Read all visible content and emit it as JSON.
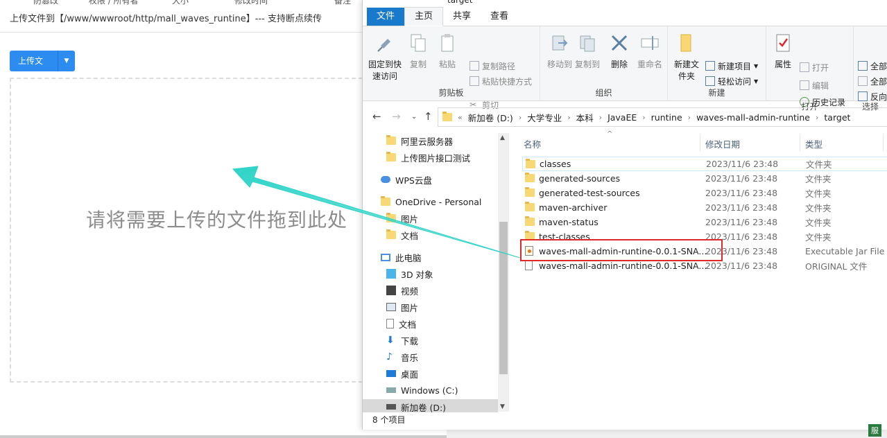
{
  "upload": {
    "col_headers": [
      "防篡改",
      "权限 / 所有者",
      "大小",
      "修改时间",
      "备注"
    ],
    "title": "上传文件到【/www/wwwroot/http/mall_waves_runtine】--- 支持断点续传",
    "upload_button": "上传文件",
    "drop_hint": "请将需要上传的文件拖到此处"
  },
  "explorer": {
    "window_title": "target",
    "tabs": [
      "文件",
      "主页",
      "共享",
      "查看"
    ],
    "ribbon": {
      "clipboard": {
        "label": "剪贴板",
        "pin": "固定到快速访问",
        "copy": "复制",
        "paste": "粘贴",
        "copy_path": "复制路径",
        "paste_shortcut": "粘贴快捷方式",
        "cut": "剪切"
      },
      "organize": {
        "label": "组织",
        "move_to": "移动到",
        "copy_to": "复制到",
        "delete": "删除",
        "rename": "重命名"
      },
      "new": {
        "label": "新建",
        "new_folder": "新建文件夹",
        "new_item": "新建项目",
        "easy_access": "轻松访问"
      },
      "open": {
        "label": "打开",
        "properties": "属性",
        "open": "打开",
        "edit": "编辑",
        "history": "历史记录"
      },
      "select": {
        "label": "选择",
        "select_all": "全部",
        "select_none": "全部",
        "invert": "反向"
      }
    },
    "breadcrumb": [
      "新加卷 (D:)",
      "大学专业",
      "本科",
      "JavaEE",
      "runtine",
      "waves-mall-admin-runtine",
      "target"
    ],
    "nav_items": [
      "阿里云服务器",
      "上传图片接口测试",
      "WPS云盘",
      "OneDrive - Personal",
      "图片",
      "文档",
      "此电脑",
      "3D 对象",
      "视频",
      "图片",
      "文档",
      "下载",
      "音乐",
      "桌面",
      "Windows (C:)",
      "新加卷 (D:)"
    ],
    "columns": {
      "name": "名称",
      "date": "修改日期",
      "type": "类型"
    },
    "files": [
      {
        "name": "classes",
        "date": "2023/11/6 23:48",
        "type": "文件夹",
        "icon": "folder-icon"
      },
      {
        "name": "generated-sources",
        "date": "2023/11/6 23:48",
        "type": "文件夹",
        "icon": "folder-icon"
      },
      {
        "name": "generated-test-sources",
        "date": "2023/11/6 23:48",
        "type": "文件夹",
        "icon": "folder-icon"
      },
      {
        "name": "maven-archiver",
        "date": "2023/11/6 23:48",
        "type": "文件夹",
        "icon": "folder-icon"
      },
      {
        "name": "maven-status",
        "date": "2023/11/6 23:48",
        "type": "文件夹",
        "icon": "folder-icon"
      },
      {
        "name": "test-classes",
        "date": "2023/11/6 23:48",
        "type": "文件夹",
        "icon": "folder-icon"
      },
      {
        "name": "waves-mall-admin-runtine-0.0.1-SNA...",
        "date": "2023/11/6 23:48",
        "type": "Executable Jar File",
        "icon": "jar-file-icon"
      },
      {
        "name": "waves-mall-admin-runtine-0.0.1-SNA...",
        "date": "2023/11/6 23:48",
        "type": "ORIGINAL 文件",
        "icon": "file-icon"
      }
    ],
    "status": "8 个项目"
  },
  "corner_badge": "服",
  "colors": {
    "accent": "#2d8cf0",
    "file_tab": "#1979ca",
    "highlight": "#e0282a",
    "arrow": "#2fd4c8"
  }
}
